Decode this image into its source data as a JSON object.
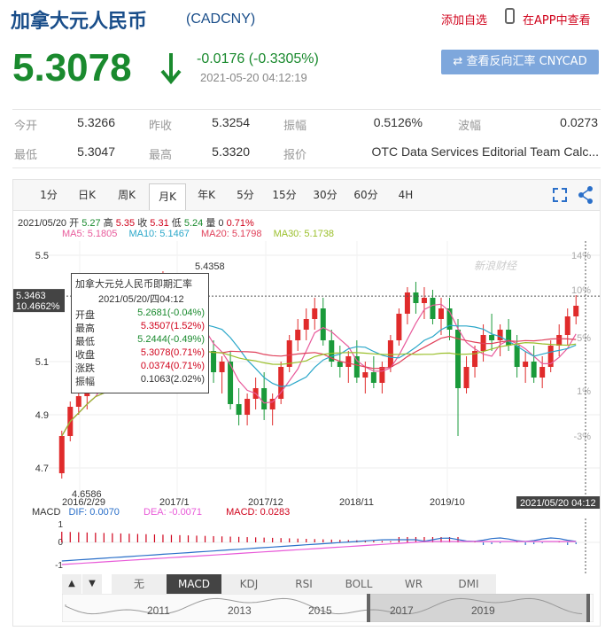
{
  "header": {
    "title": "加拿大元人民币",
    "code": "(CADCNY)",
    "add_watchlist": "添加自选",
    "view_app": "在APP中查看",
    "price": "5.3078",
    "change": "-0.0176 (-0.3305%)",
    "timestamp": "2021-05-20 04:12:19",
    "reverse_button": "查看反向汇率 CNYCAD",
    "colors": {
      "down": "#1a8a2e",
      "up": "#d0021b",
      "brand": "#1a4e8a"
    }
  },
  "stats": [
    {
      "label": "今开",
      "value": "5.3266"
    },
    {
      "label": "昨收",
      "value": "5.3254"
    },
    {
      "label": "振幅",
      "value": "0.5126%"
    },
    {
      "label": "波幅",
      "value": "0.0273"
    },
    {
      "label": "最低",
      "value": "5.3047"
    },
    {
      "label": "最高",
      "value": "5.3320"
    },
    {
      "label": "报价",
      "value": "OTC Data Services Editorial Team Calc..."
    }
  ],
  "tabs": [
    "1分",
    "日K",
    "周K",
    "月K",
    "年K",
    "5分",
    "15分",
    "30分",
    "60分",
    "4H"
  ],
  "active_tab": "月K",
  "chart_info": {
    "date": "2021/05/20",
    "open_label": "开",
    "open": "5.27",
    "high_label": "高",
    "high": "5.35",
    "close_label": "收",
    "close": "5.31",
    "low_label": "低",
    "low": "5.24",
    "vol_label": "量",
    "vol": "0",
    "pct": "0.71%"
  },
  "ma": [
    {
      "label": "MA5: 5.1805",
      "color": "#e85a9b"
    },
    {
      "label": "MA10: 5.1467",
      "color": "#2aa7c9"
    },
    {
      "label": "MA20: 5.1798",
      "color": "#e0405a"
    },
    {
      "label": "MA30: 5.1738",
      "color": "#9abf2a"
    }
  ],
  "tooltip": {
    "title": "加拿大元兑人民币即期汇率",
    "date": "2021/05/20/四04:12",
    "rows": [
      {
        "label": "开盘",
        "value": "5.2681(-0.04%)",
        "color": "#1a8a2e"
      },
      {
        "label": "最高",
        "value": "5.3507(1.52%)",
        "color": "#d0021b"
      },
      {
        "label": "最低",
        "value": "5.2444(-0.49%)",
        "color": "#1a8a2e"
      },
      {
        "label": "收盘",
        "value": "5.3078(0.71%)",
        "color": "#d0021b"
      },
      {
        "label": "涨跌",
        "value": "0.0374(0.71%)",
        "color": "#d0021b"
      },
      {
        "label": "振幅",
        "value": "0.1063(2.02%)",
        "color": "#333333"
      }
    ]
  },
  "chart_data": {
    "type": "candlestick",
    "y_ticks_left": [
      "5.5",
      "5.1",
      "4.9",
      "4.7"
    ],
    "y_ticks_right": [
      "14%",
      "10%",
      "5%",
      "1%",
      "-3%"
    ],
    "x_ticks": [
      "2016/2/29",
      "2017/1",
      "2017/12",
      "2018/11",
      "2019/10"
    ],
    "cursor_price": "5.3463",
    "cursor_pct": "10.4662%",
    "cursor_time": "2021/05/20 04:12",
    "high_annotation": "5.4358",
    "low_annotation": "4.6586",
    "ylim": [
      4.62,
      5.52
    ],
    "watermark": "新浪财经",
    "candles": [
      [
        4.68,
        4.84,
        4.66,
        4.82
      ],
      [
        4.82,
        4.95,
        4.8,
        4.93
      ],
      [
        4.93,
        5.02,
        4.9,
        4.97
      ],
      [
        4.97,
        5.06,
        4.92,
        5.04
      ],
      [
        5.04,
        5.12,
        5.0,
        5.08
      ],
      [
        5.08,
        5.14,
        5.02,
        5.05
      ],
      [
        5.05,
        5.13,
        5.01,
        5.12
      ],
      [
        5.12,
        5.18,
        5.08,
        5.1
      ],
      [
        5.1,
        5.16,
        5.05,
        5.14
      ],
      [
        5.14,
        5.22,
        5.1,
        5.2
      ],
      [
        5.2,
        5.28,
        5.15,
        5.25
      ],
      [
        5.25,
        5.33,
        5.2,
        5.3
      ],
      [
        5.3,
        5.44,
        5.26,
        5.4
      ],
      [
        5.4,
        5.43,
        5.3,
        5.32
      ],
      [
        5.32,
        5.38,
        5.22,
        5.26
      ],
      [
        5.26,
        5.3,
        5.14,
        5.18
      ],
      [
        5.18,
        5.24,
        5.1,
        5.2
      ],
      [
        5.2,
        5.23,
        5.12,
        5.14
      ],
      [
        5.14,
        5.18,
        5.02,
        5.06
      ],
      [
        5.06,
        5.12,
        4.98,
        5.1
      ],
      [
        5.1,
        5.14,
        4.92,
        4.94
      ],
      [
        4.94,
        5.0,
        4.86,
        4.9
      ],
      [
        4.9,
        4.98,
        4.86,
        4.96
      ],
      [
        4.96,
        5.04,
        4.92,
        5.0
      ],
      [
        5.0,
        5.06,
        4.88,
        4.92
      ],
      [
        4.92,
        4.98,
        4.86,
        4.96
      ],
      [
        4.96,
        5.1,
        4.94,
        5.08
      ],
      [
        5.08,
        5.2,
        5.06,
        5.18
      ],
      [
        5.18,
        5.26,
        5.14,
        5.22
      ],
      [
        5.22,
        5.3,
        5.18,
        5.26
      ],
      [
        5.26,
        5.34,
        5.22,
        5.3
      ],
      [
        5.3,
        5.34,
        5.16,
        5.18
      ],
      [
        5.18,
        5.22,
        5.08,
        5.1
      ],
      [
        5.1,
        5.16,
        5.04,
        5.08
      ],
      [
        5.08,
        5.14,
        5.02,
        5.12
      ],
      [
        5.12,
        5.18,
        5.02,
        5.04
      ],
      [
        5.04,
        5.1,
        4.98,
        5.06
      ],
      [
        5.06,
        5.12,
        5.0,
        5.02
      ],
      [
        5.02,
        5.1,
        4.98,
        5.08
      ],
      [
        5.08,
        5.2,
        5.06,
        5.18
      ],
      [
        5.18,
        5.3,
        5.16,
        5.28
      ],
      [
        5.28,
        5.38,
        5.24,
        5.36
      ],
      [
        5.36,
        5.4,
        5.28,
        5.32
      ],
      [
        5.32,
        5.38,
        5.26,
        5.34
      ],
      [
        5.34,
        5.37,
        5.24,
        5.26
      ],
      [
        5.26,
        5.34,
        5.2,
        5.3
      ],
      [
        5.3,
        5.34,
        5.18,
        5.22
      ],
      [
        5.22,
        5.26,
        4.82,
        5.0
      ],
      [
        5.0,
        5.12,
        4.98,
        5.08
      ],
      [
        5.08,
        5.16,
        5.04,
        5.14
      ],
      [
        5.14,
        5.24,
        5.1,
        5.2
      ],
      [
        5.2,
        5.28,
        5.14,
        5.18
      ],
      [
        5.18,
        5.24,
        5.12,
        5.22
      ],
      [
        5.22,
        5.26,
        5.14,
        5.16
      ],
      [
        5.16,
        5.2,
        5.04,
        5.08
      ],
      [
        5.08,
        5.14,
        5.02,
        5.1
      ],
      [
        5.1,
        5.16,
        5.02,
        5.04
      ],
      [
        5.04,
        5.12,
        5.0,
        5.08
      ],
      [
        5.08,
        5.18,
        5.06,
        5.16
      ],
      [
        5.16,
        5.24,
        5.12,
        5.2
      ],
      [
        5.2,
        5.3,
        5.16,
        5.27
      ],
      [
        5.27,
        5.35,
        5.24,
        5.31
      ]
    ]
  },
  "macd": {
    "label": "MACD",
    "dif": "DIF: 0.0070",
    "dea": "DEA: -0.0071",
    "macd": "MACD: 0.0283",
    "y_ticks": [
      "1",
      "0",
      "-1"
    ]
  },
  "indicators": [
    "无",
    "MACD",
    "KDJ",
    "RSI",
    "BOLL",
    "WR",
    "DMI"
  ],
  "active_indicator": "MACD",
  "nav_years": [
    "2011",
    "2013",
    "2015",
    "2017",
    "2019"
  ]
}
